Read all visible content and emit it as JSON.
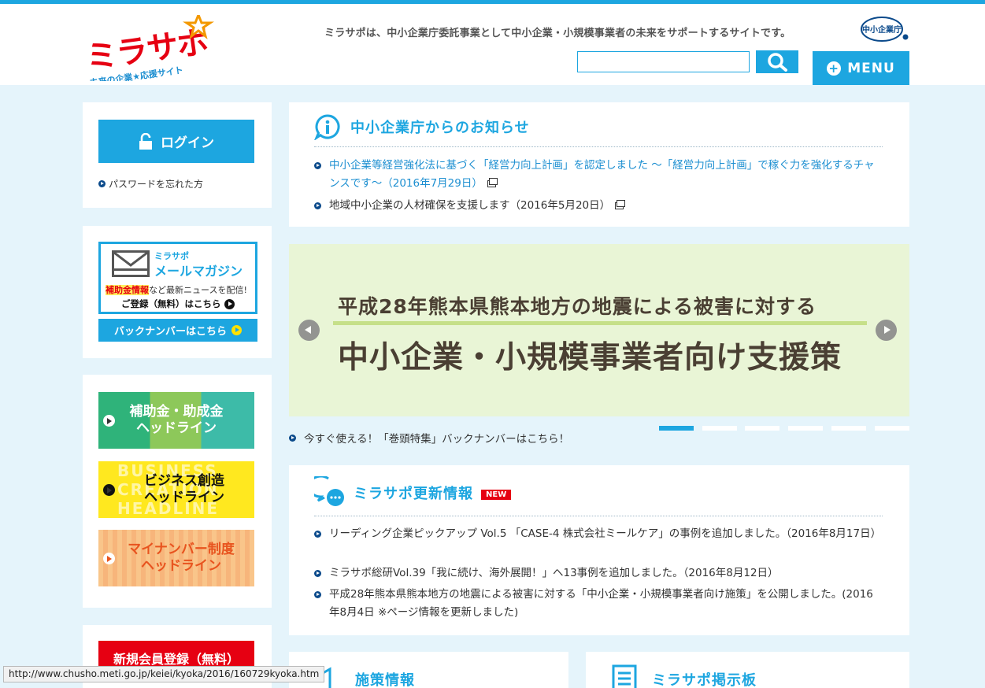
{
  "header": {
    "logo_text": "ミラサポ",
    "logo_subtitle": "未来の企業★応援サイト",
    "tagline": "ミラサポは、中小企業庁委託事業として中小企業・小規模事業者の未来をサポートするサイトです。",
    "agency_logo_text": "中小企業庁",
    "search_value": "",
    "menu_label": "MENU"
  },
  "sidebar": {
    "login_label": "ログイン",
    "forgot_password": "パスワードを忘れた方",
    "mail_magazine": {
      "small": "ミラサポ",
      "title": "メールマガジン",
      "highlight": "補助金情報",
      "rest": "など最新ニュースを配信!",
      "register": "ご登録（無料）はこちら",
      "backnumber": "バックナンバーはこちら"
    },
    "headlines": [
      {
        "label": "補助金・助成金\nヘッドライン"
      },
      {
        "label": "ビジネス創造\nヘッドライン",
        "bg_text": "BUSINESS\nCREATION\nHEADLINE"
      },
      {
        "label": "マイナンバー制度\nヘッドライン"
      }
    ],
    "new_member": "新規会員登録（無料）"
  },
  "notice": {
    "title": "中小企業庁からのお知らせ",
    "items": [
      "中小企業等経営強化法に基づく「経営力向上計画」を認定しました ～「経営力向上計画」で稼ぐ力を強化するチャンスです～（2016年7月29日）",
      "地域中小企業の人材確保を支援します（2016年5月20日）"
    ]
  },
  "banner": {
    "line1": "平成28年熊本県熊本地方の地震による被害に対する",
    "line2": "中小企業・小規模事業者向け支援策",
    "below_link": "今すぐ使える！「巻頭特集」バックナンバーはこちら！",
    "slide_count": 6,
    "active_slide": 1
  },
  "updates": {
    "title": "ミラサポ更新情報",
    "badge": "NEW",
    "items": [
      "リーディング企業ピックアップ Vol.5 「CASE-4 株式会社ミールケア」の事例を追加しました。（2016年8月17日）",
      "ミラサポ総研Vol.39「我に続け、海外展開！」へ13事例を追加しました。（2016年8月12日）",
      "平成28年熊本県熊本地方の地震による被害に対する「中小企業・小規模事業者向け施策」を公開しました。(2016年8月4日 ※ページ情報を更新しました)"
    ]
  },
  "bottom": {
    "policy_title": "施策情報",
    "board_title": "ミラサポ掲示板"
  },
  "status_url": "http://www.chusho.meti.go.jp/keiei/kyoka/2016/160729kyoka.htm",
  "colors": {
    "accent": "#1da6e0",
    "background": "#e5f4fb",
    "brand_red": "#e60012",
    "link": "#1d8fd1"
  }
}
